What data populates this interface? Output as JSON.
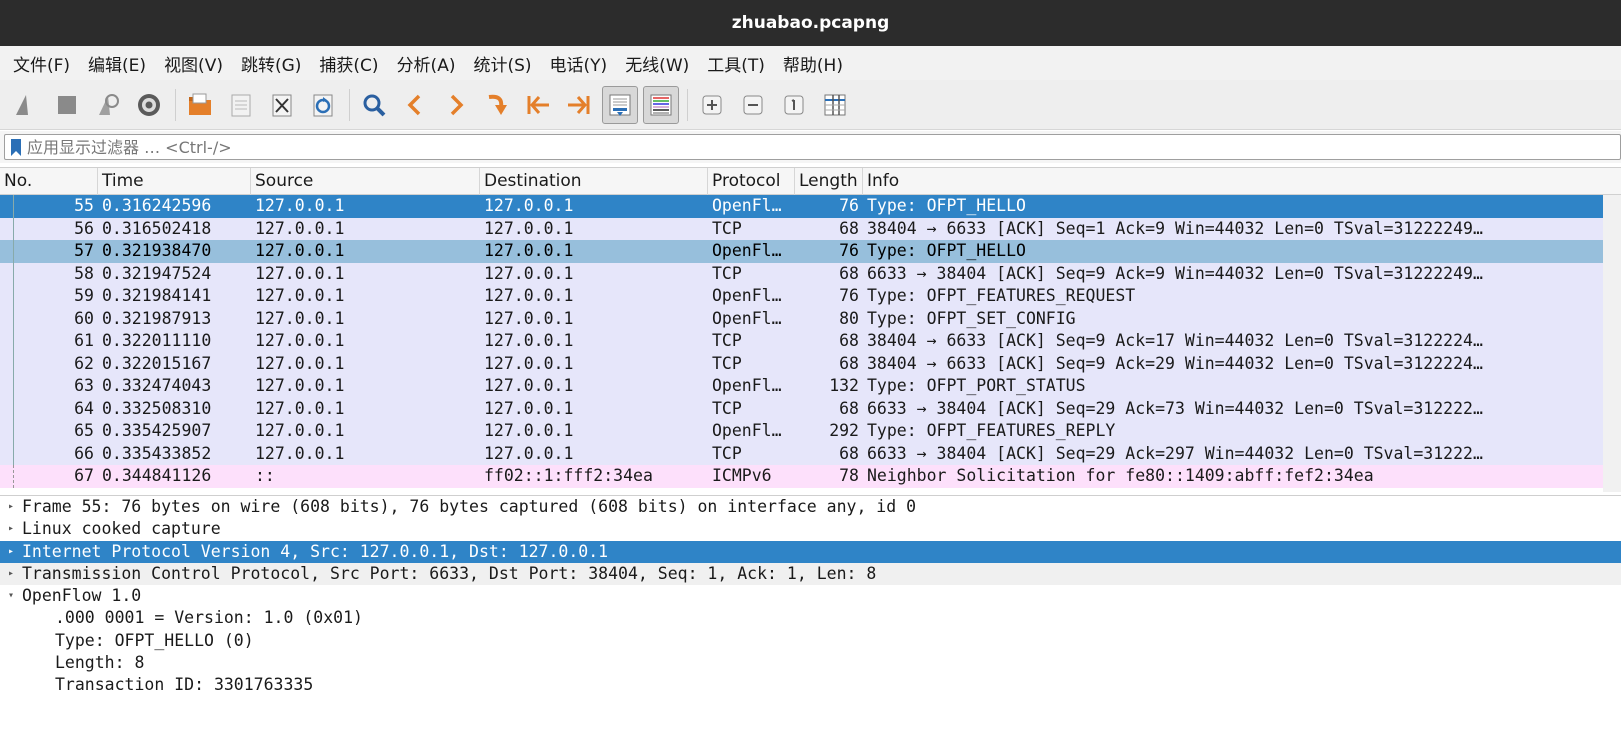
{
  "window": {
    "title": "zhuabao.pcapng"
  },
  "menu": [
    "文件(F)",
    "编辑(E)",
    "视图(V)",
    "跳转(G)",
    "捕获(C)",
    "分析(A)",
    "统计(S)",
    "电话(Y)",
    "无线(W)",
    "工具(T)",
    "帮助(H)"
  ],
  "toolbar": {
    "icons": [
      "shark-fin-start-icon",
      "stop-icon",
      "restart-icon",
      "gear-options-icon",
      "open-folder-icon",
      "save-icon",
      "close-file-icon",
      "reload-icon",
      "find-icon",
      "back-icon",
      "forward-icon",
      "go-to-packet-icon",
      "first-packet-icon",
      "last-packet-icon",
      "autoscroll-icon",
      "colorize-icon",
      "zoom-in-icon",
      "zoom-out-icon",
      "normal-size-icon",
      "resize-columns-icon"
    ]
  },
  "filter": {
    "placeholder": "应用显示过滤器 … <Ctrl-/>"
  },
  "columns": [
    "No.",
    "Time",
    "Source",
    "Destination",
    "Protocol",
    "Length",
    "Info"
  ],
  "packets": [
    {
      "no": "55",
      "time": "0.316242596",
      "src": "127.0.0.1",
      "dst": "127.0.0.1",
      "proto": "OpenFl…",
      "len": "76",
      "info": "Type: OFPT_HELLO",
      "style": "sel"
    },
    {
      "no": "56",
      "time": "0.316502418",
      "src": "127.0.0.1",
      "dst": "127.0.0.1",
      "proto": "TCP",
      "len": "68",
      "info": "38404 → 6633 [ACK] Seq=1 Ack=9 Win=44032 Len=0 TSval=31222249…",
      "style": "tcp"
    },
    {
      "no": "57",
      "time": "0.321938470",
      "src": "127.0.0.1",
      "dst": "127.0.0.1",
      "proto": "OpenFl…",
      "len": "76",
      "info": "Type: OFPT_HELLO",
      "style": "sel2"
    },
    {
      "no": "58",
      "time": "0.321947524",
      "src": "127.0.0.1",
      "dst": "127.0.0.1",
      "proto": "TCP",
      "len": "68",
      "info": "6633 → 38404 [ACK] Seq=9 Ack=9 Win=44032 Len=0 TSval=31222249…",
      "style": "tcp"
    },
    {
      "no": "59",
      "time": "0.321984141",
      "src": "127.0.0.1",
      "dst": "127.0.0.1",
      "proto": "OpenFl…",
      "len": "76",
      "info": "Type: OFPT_FEATURES_REQUEST",
      "style": "tcp"
    },
    {
      "no": "60",
      "time": "0.321987913",
      "src": "127.0.0.1",
      "dst": "127.0.0.1",
      "proto": "OpenFl…",
      "len": "80",
      "info": "Type: OFPT_SET_CONFIG",
      "style": "tcp"
    },
    {
      "no": "61",
      "time": "0.322011110",
      "src": "127.0.0.1",
      "dst": "127.0.0.1",
      "proto": "TCP",
      "len": "68",
      "info": "38404 → 6633 [ACK] Seq=9 Ack=17 Win=44032 Len=0 TSval=3122224…",
      "style": "tcp"
    },
    {
      "no": "62",
      "time": "0.322015167",
      "src": "127.0.0.1",
      "dst": "127.0.0.1",
      "proto": "TCP",
      "len": "68",
      "info": "38404 → 6633 [ACK] Seq=9 Ack=29 Win=44032 Len=0 TSval=3122224…",
      "style": "tcp"
    },
    {
      "no": "63",
      "time": "0.332474043",
      "src": "127.0.0.1",
      "dst": "127.0.0.1",
      "proto": "OpenFl…",
      "len": "132",
      "info": "Type: OFPT_PORT_STATUS",
      "style": "tcp"
    },
    {
      "no": "64",
      "time": "0.332508310",
      "src": "127.0.0.1",
      "dst": "127.0.0.1",
      "proto": "TCP",
      "len": "68",
      "info": "6633 → 38404 [ACK] Seq=29 Ack=73 Win=44032 Len=0 TSval=312222…",
      "style": "tcp"
    },
    {
      "no": "65",
      "time": "0.335425907",
      "src": "127.0.0.1",
      "dst": "127.0.0.1",
      "proto": "OpenFl…",
      "len": "292",
      "info": "Type: OFPT_FEATURES_REPLY",
      "style": "tcp"
    },
    {
      "no": "66",
      "time": "0.335433852",
      "src": "127.0.0.1",
      "dst": "127.0.0.1",
      "proto": "TCP",
      "len": "68",
      "info": "6633 → 38404 [ACK] Seq=29 Ack=297 Win=44032 Len=0 TSval=31222…",
      "style": "tcp"
    },
    {
      "no": "67",
      "time": "0.344841126",
      "src": "::",
      "dst": "ff02::1:fff2:34ea",
      "proto": "ICMPv6",
      "len": "78",
      "info": "Neighbor Solicitation for fe80::1409:abff:fef2:34ea",
      "style": "icmp"
    }
  ],
  "details": [
    {
      "text": "Frame 55: 76 bytes on wire (608 bits), 76 bytes captured (608 bits) on interface any, id 0",
      "arrow": "▸",
      "style": ""
    },
    {
      "text": "Linux cooked capture",
      "arrow": "▸",
      "style": ""
    },
    {
      "text": "Internet Protocol Version 4, Src: 127.0.0.1, Dst: 127.0.0.1",
      "arrow": "▸",
      "style": "sel"
    },
    {
      "text": "Transmission Control Protocol, Src Port: 6633, Dst Port: 38404, Seq: 1, Ack: 1, Len: 8",
      "arrow": "▸",
      "style": "hover"
    },
    {
      "text": "OpenFlow 1.0",
      "arrow": "▾",
      "style": ""
    }
  ],
  "openflow_fields": [
    ".000 0001 = Version: 1.0 (0x01)",
    "Type: OFPT_HELLO (0)",
    "Length: 8",
    "Transaction ID: 3301763335"
  ]
}
